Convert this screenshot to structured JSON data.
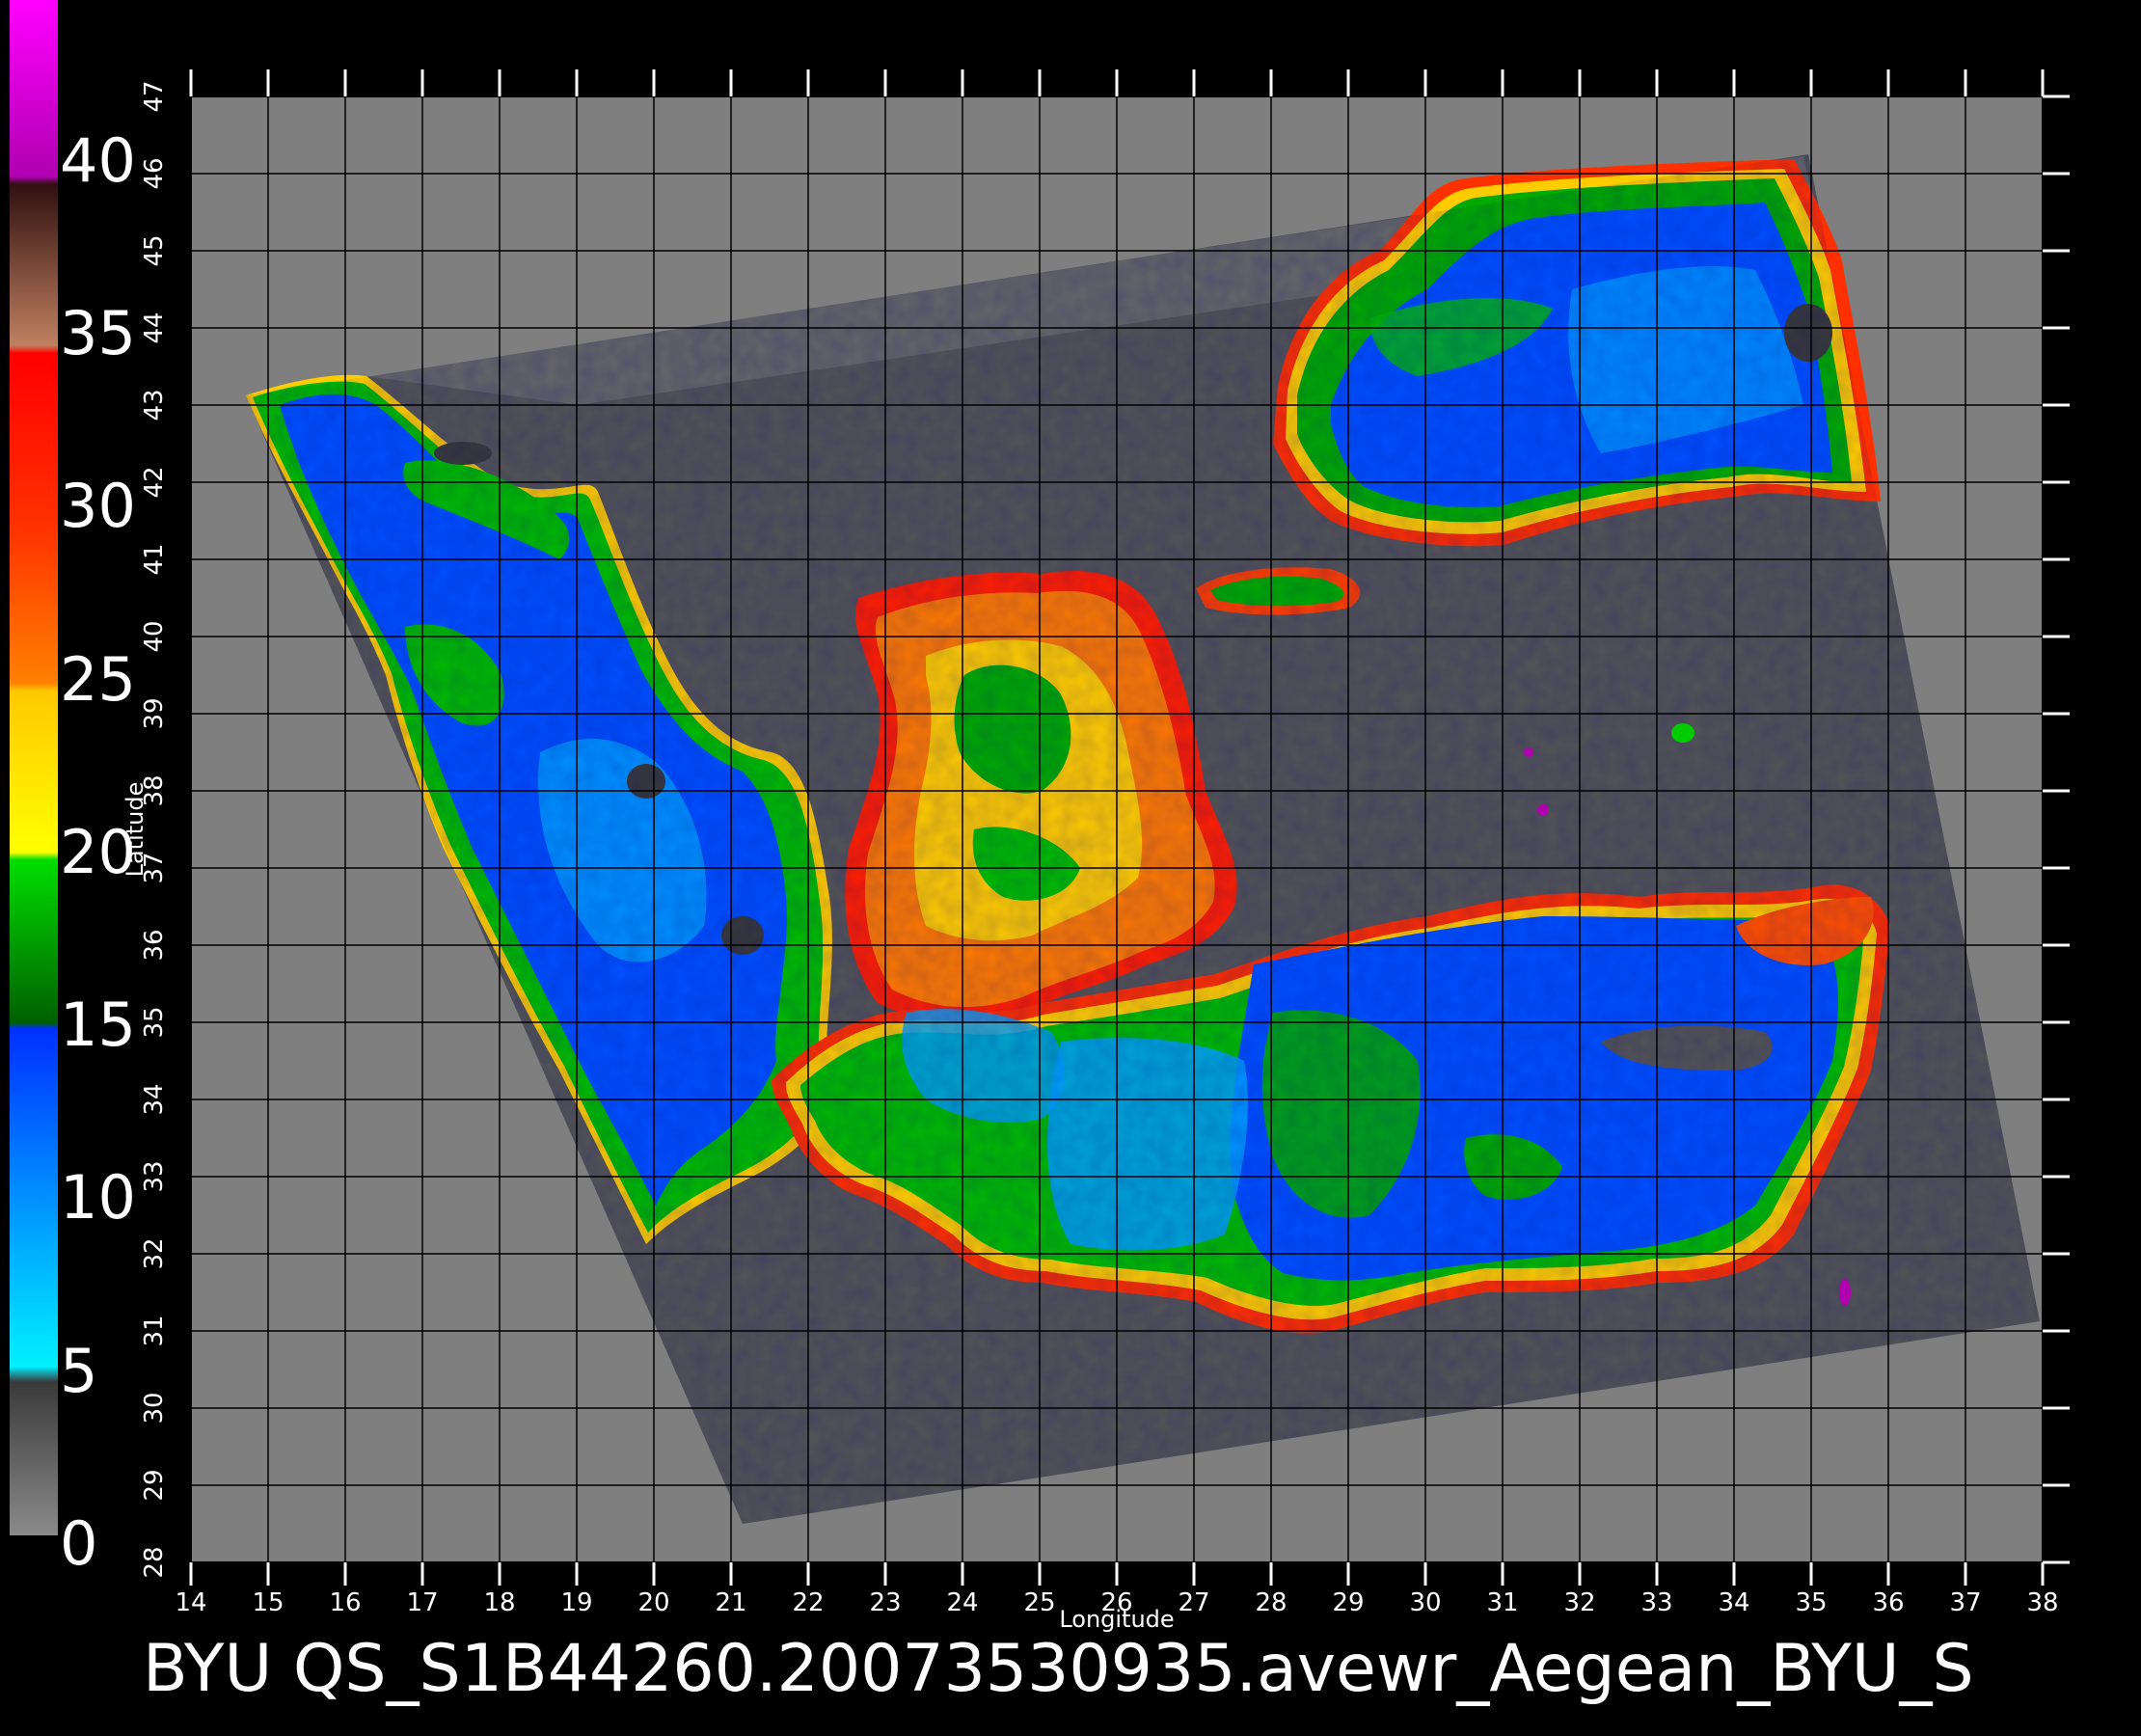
{
  "title": "BYU QS_S1B44260.20073530935.avewr_Aegean_BYU_S",
  "axes": {
    "xlabel": "Longitude",
    "ylabel": "Latitude",
    "x_ticks": [
      "14",
      "15",
      "16",
      "17",
      "18",
      "19",
      "20",
      "21",
      "22",
      "23",
      "24",
      "25",
      "26",
      "27",
      "28",
      "29",
      "30",
      "31",
      "32",
      "33",
      "34",
      "35",
      "36",
      "37",
      "38"
    ],
    "y_ticks": [
      "28",
      "29",
      "30",
      "31",
      "32",
      "33",
      "34",
      "35",
      "36",
      "37",
      "38",
      "39",
      "40",
      "41",
      "42",
      "43",
      "44",
      "45",
      "46",
      "47"
    ],
    "xlim": [
      14,
      38
    ],
    "ylim": [
      28,
      47
    ]
  },
  "colorbar": {
    "labels": [
      "0",
      "5",
      "10",
      "15",
      "20",
      "25",
      "30",
      "35",
      "40"
    ],
    "colors": {
      "gray": "#7a7a7a",
      "dark_gray": "#3a3a3a",
      "cyan": "#00e8ff",
      "blue": "#0040ff",
      "green": "#00cc00",
      "yellow": "#ffee00",
      "orange": "#ff8000",
      "red": "#ff1000",
      "brown": "#6a2a20",
      "magenta": "#ff00ff"
    }
  },
  "map": {
    "background": "#7f7f7f",
    "swath": "#555555",
    "grid_line": "#000000"
  }
}
